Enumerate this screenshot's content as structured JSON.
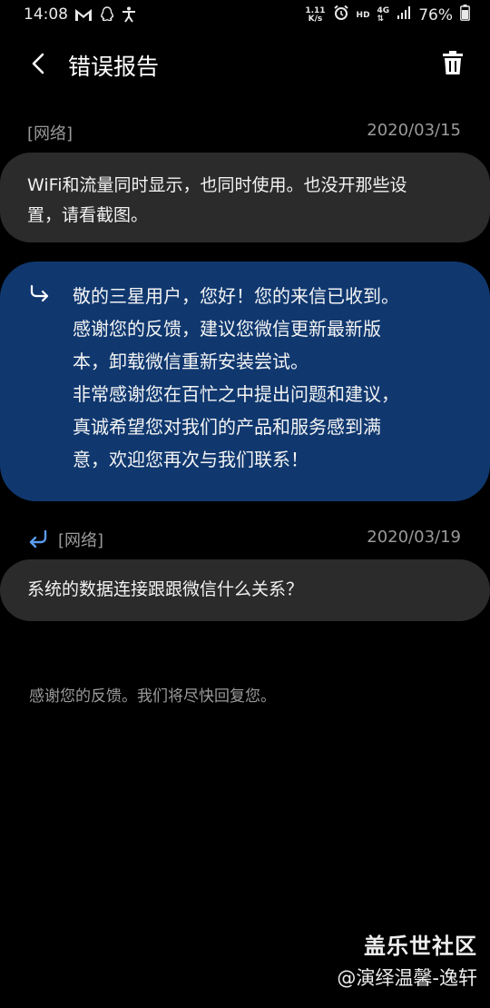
{
  "status_bar": {
    "time": "14:08",
    "left_icons": [
      "gmail-icon",
      "qq-icon",
      "accessibility-icon"
    ],
    "net_speed_value": "1.11",
    "net_speed_unit": "K/s",
    "hd_label": "HD",
    "network_type": "4G",
    "battery_percent": "76%"
  },
  "app_bar": {
    "title": "错误报告"
  },
  "messages": [
    {
      "category": "[网络]",
      "date": "2020/03/15",
      "text_lines": [
        "WiFi和流量同时显示，也同时使用。也没开那些设",
        "置，请看截图。"
      ]
    },
    {
      "reply_lines": [
        "敬的三星用户，您好！您的来信已收到。",
        "感谢您的反馈，建议您微信更新最新版",
        "本，卸载微信重新安装尝试。",
        "非常感谢您在百忙之中提出问题和建议，",
        "真诚希望您对我们的产品和服务感到满",
        "意，欢迎您再次与我们联系！"
      ]
    },
    {
      "category": "[网络]",
      "date": "2020/03/19",
      "text_lines": [
        "系统的数据连接跟跟微信什么关系？"
      ]
    }
  ],
  "footer_note": "感谢您的反馈。我们将尽快回复您。",
  "watermark": {
    "brand": "盖乐世社区",
    "user": "@演绎温馨-逸轩"
  },
  "colors": {
    "background": "#000000",
    "user_bubble": "#2b2b2b",
    "reply_bubble": "#10386f",
    "accent_icon": "#5b9bf0",
    "meta_text": "#9a9a9a"
  }
}
